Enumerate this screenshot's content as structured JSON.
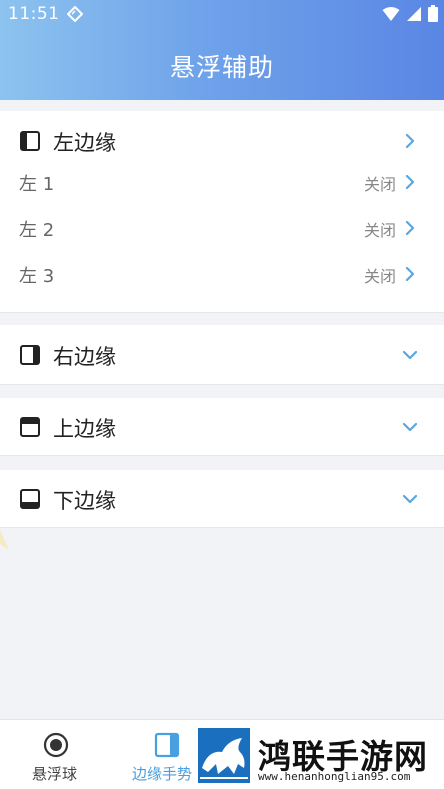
{
  "status_bar": {
    "time": "11:51",
    "icons": [
      "diamond-icon",
      "wifi-icon",
      "signal-icon",
      "battery-icon"
    ]
  },
  "header": {
    "title": "悬浮辅助",
    "gradient": [
      "#8cc3ef",
      "#5a86e4"
    ]
  },
  "sections": {
    "left": {
      "label": "左边缘",
      "expanded": true,
      "icon": "left-edge-icon",
      "rows": [
        {
          "label": "左 1",
          "status": "关闭"
        },
        {
          "label": "左 2",
          "status": "关闭"
        },
        {
          "label": "左 3",
          "status": "关闭"
        }
      ]
    },
    "right": {
      "label": "右边缘",
      "expanded": false,
      "icon": "right-edge-icon"
    },
    "top": {
      "label": "上边缘",
      "expanded": false,
      "icon": "top-edge-icon"
    },
    "bottom": {
      "label": "下边缘",
      "expanded": false,
      "icon": "bottom-edge-icon"
    }
  },
  "tabbar": {
    "tabs": [
      {
        "label": "悬浮球",
        "icon": "floating-ball-icon",
        "active": false
      },
      {
        "label": "边缘手势",
        "icon": "edge-gesture-icon",
        "active": true
      }
    ]
  },
  "watermark": {
    "title": "鸿联手游网",
    "url": "www.henanhonglian95.com"
  },
  "colors": {
    "accent": "#4a9fe0",
    "chevron": "#5aa6de",
    "text_primary": "#222222",
    "text_secondary": "#888888"
  }
}
